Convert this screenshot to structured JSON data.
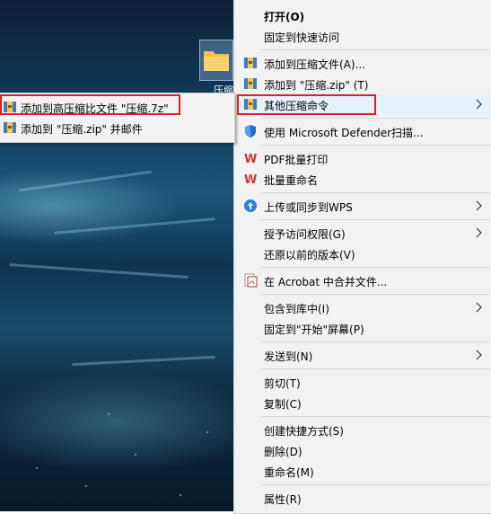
{
  "desktop": {
    "folder_label": "压缩"
  },
  "context_menu": {
    "items": [
      {
        "label": "打开(O)",
        "icon": "none"
      },
      {
        "label": "固定到快速访问",
        "icon": "none"
      },
      {
        "label": "添加到压缩文件(A)...",
        "icon": "archive-icon"
      },
      {
        "label": "添加到 \"压缩.zip\" (T)",
        "icon": "archive-icon"
      },
      {
        "label": "其他压缩命令",
        "icon": "archive-icon",
        "has_submenu": true,
        "highlighted": true
      },
      {
        "label": "使用 Microsoft Defender扫描...",
        "icon": "defender-shield-icon"
      },
      {
        "label": "PDF批量打印",
        "icon": "wps-icon"
      },
      {
        "label": "批量重命名",
        "icon": "wps-icon"
      },
      {
        "label": "上传或同步到WPS",
        "icon": "cloud-upload-icon",
        "has_submenu": true
      },
      {
        "label": "授予访问权限(G)",
        "icon": "none",
        "has_submenu": true
      },
      {
        "label": "还原以前的版本(V)",
        "icon": "none"
      },
      {
        "label": "在 Acrobat 中合并文件...",
        "icon": "acrobat-icon"
      },
      {
        "label": "包含到库中(I)",
        "icon": "none",
        "has_submenu": true
      },
      {
        "label": "固定到\"开始\"屏幕(P)",
        "icon": "none"
      },
      {
        "label": "发送到(N)",
        "icon": "none",
        "has_submenu": true
      },
      {
        "label": "剪切(T)",
        "icon": "none"
      },
      {
        "label": "复制(C)",
        "icon": "none"
      },
      {
        "label": "创建快捷方式(S)",
        "icon": "none"
      },
      {
        "label": "删除(D)",
        "icon": "none"
      },
      {
        "label": "重命名(M)",
        "icon": "none"
      },
      {
        "label": "属性(R)",
        "icon": "none"
      }
    ]
  },
  "submenu": {
    "items": [
      {
        "label": "添加到高压缩比文件 \"压缩.7z\"",
        "icon": "archive-icon"
      },
      {
        "label": "添加到 \"压缩.zip\" 并邮件",
        "icon": "archive-icon"
      }
    ]
  },
  "colors": {
    "highlight": "#e5f1fb",
    "annotation_red": "#e02020",
    "menu_bg": "#f2f2f2"
  }
}
